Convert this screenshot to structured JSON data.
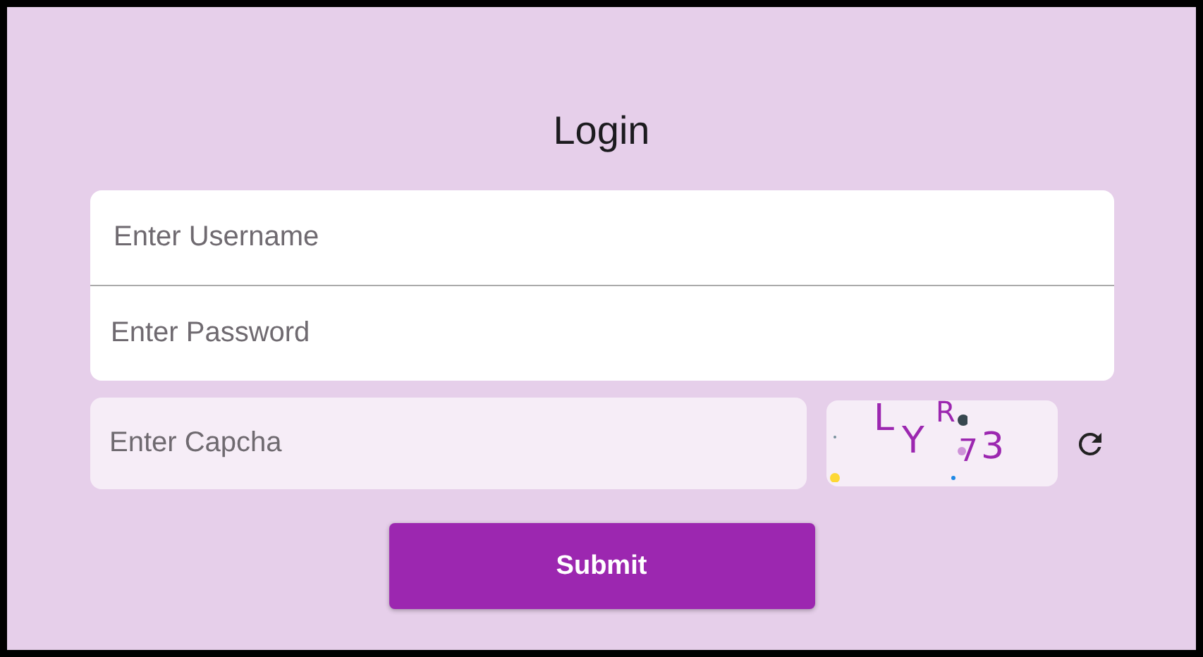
{
  "title": "Login",
  "fields": [
    {
      "placeholder": "Enter Username"
    },
    {
      "placeholder": "Enter Password"
    }
  ],
  "captcha_field": {
    "placeholder": "Enter Capcha"
  },
  "captcha_characters": [
    "L",
    "Y",
    "R",
    "7",
    "3"
  ],
  "submit_button": "Submit"
}
